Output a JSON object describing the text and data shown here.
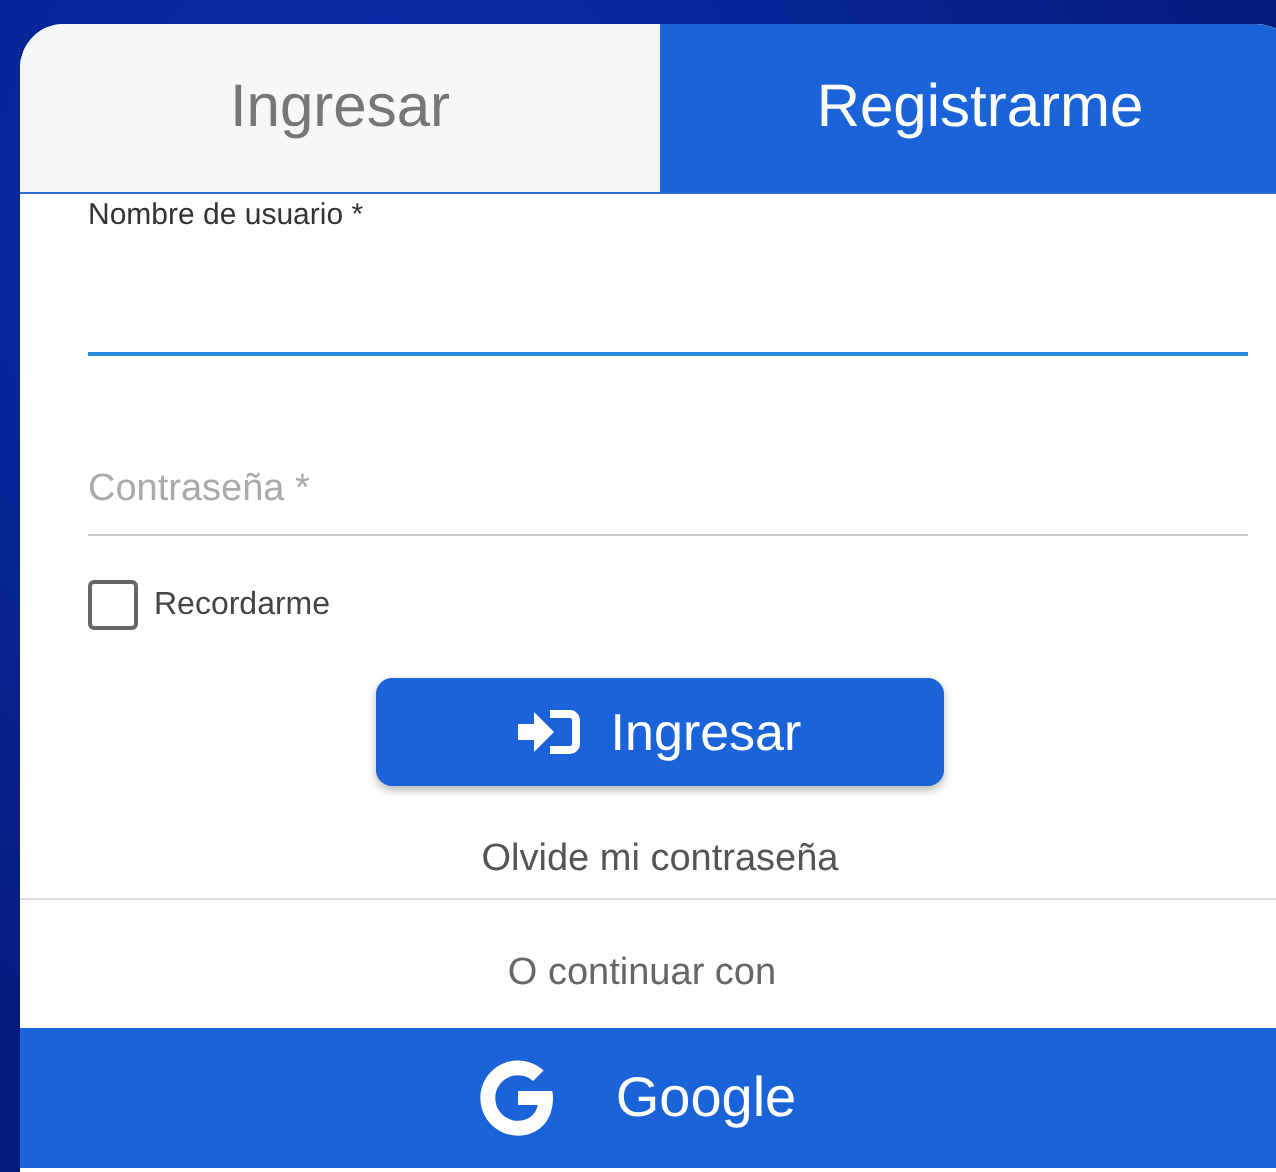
{
  "tabs": [
    {
      "label": "Ingresar",
      "selected": true
    },
    {
      "label": "Registrarme",
      "selected": false
    }
  ],
  "fields": [
    {
      "kind": "text",
      "label": "Nombre de usuario *",
      "focused": true
    },
    {
      "kind": "password",
      "placeholder": "Contraseña *",
      "focused": false
    }
  ],
  "remember": {
    "label": "Recordarme",
    "checked": false
  },
  "submit": {
    "label": "Ingresar"
  },
  "forgot_link": "Olvide mi contraseña",
  "divider_text": "O continuar con",
  "google_button": {
    "label": "Google"
  }
}
